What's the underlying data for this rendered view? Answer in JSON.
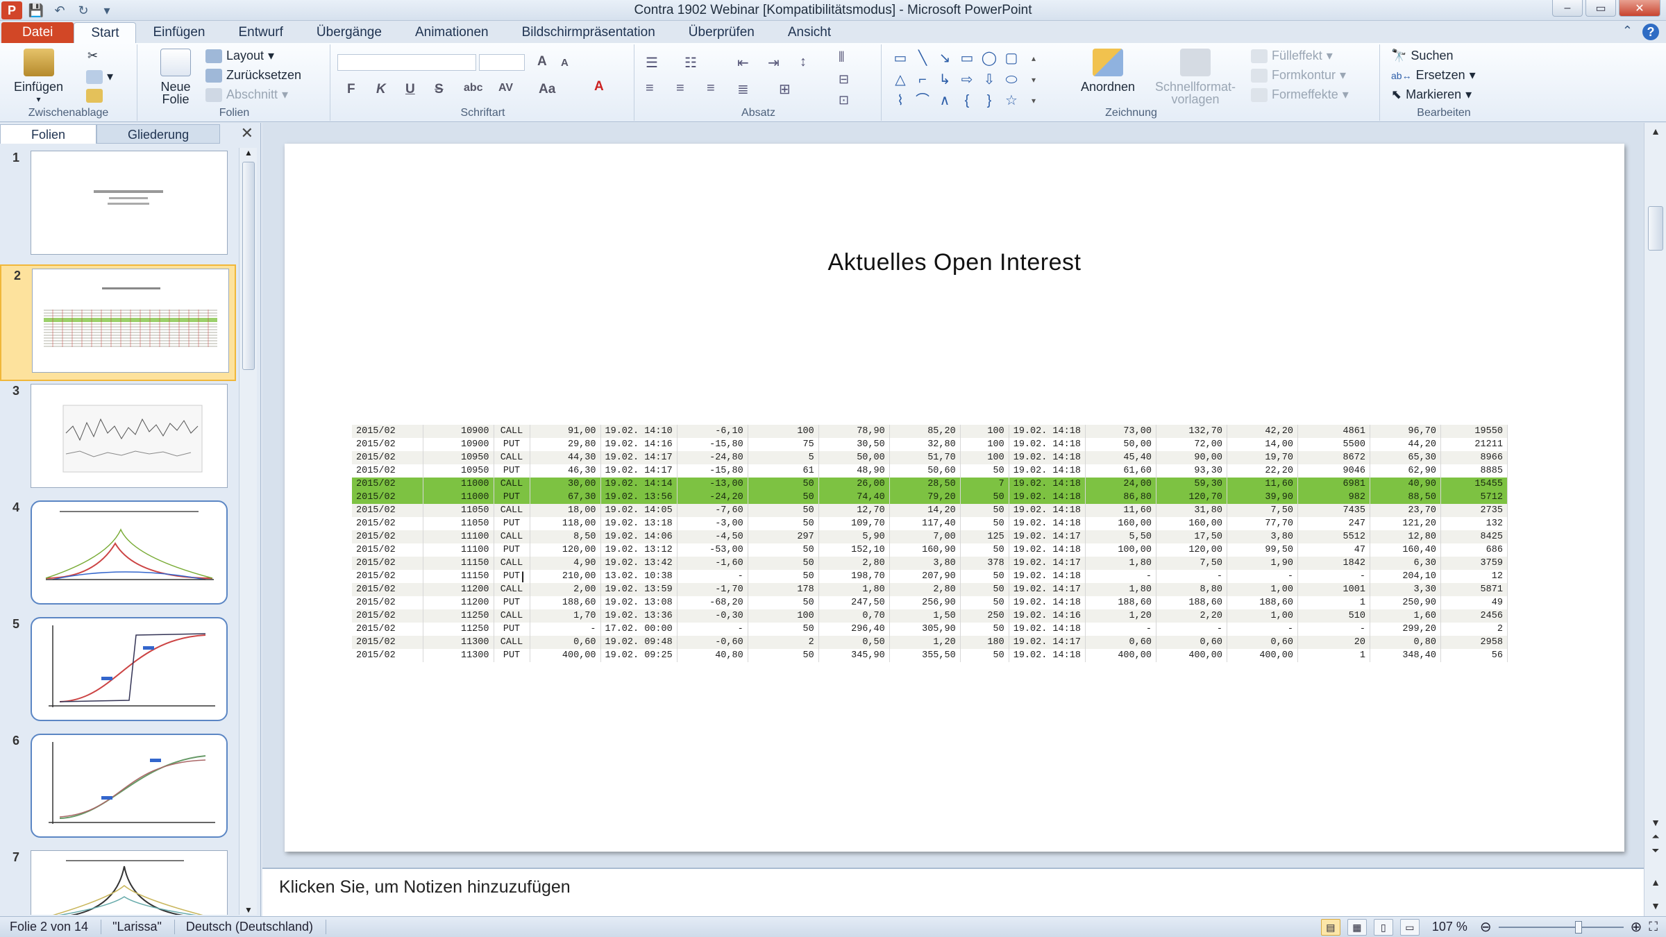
{
  "window": {
    "title": "Contra 1902 Webinar [Kompatibilitätsmodus] - Microsoft PowerPoint",
    "app_icon": "P",
    "controls": [
      "–",
      "▭",
      "✕"
    ]
  },
  "tabs": [
    "Datei",
    "Start",
    "Einfügen",
    "Entwurf",
    "Übergänge",
    "Animationen",
    "Bildschirmpräsentation",
    "Überprüfen",
    "Ansicht"
  ],
  "ribbon": {
    "clipboard": {
      "paste": "Einfügen",
      "label": "Zwischenablage"
    },
    "slides": {
      "new_slide": "Neue Folie",
      "layout": "Layout",
      "reset": "Zurücksetzen",
      "section": "Abschnitt",
      "label": "Folien"
    },
    "font": {
      "label": "Schriftart",
      "bold": "F",
      "italic": "K",
      "underline": "U",
      "strike": "S",
      "shadow": "abc",
      "spacing": "AV",
      "case": "Aa",
      "grow": "A",
      "shrink": "A",
      "color": "A"
    },
    "paragraph": {
      "label": "Absatz"
    },
    "drawing": {
      "arrange": "Anordnen",
      "quick_styles": "Schnellformat-vorlagen",
      "fill": "Fülleffekt",
      "outline": "Formkontur",
      "effects": "Formeffekte",
      "label": "Zeichnung"
    },
    "editing": {
      "find": "Suchen",
      "replace": "Ersetzen",
      "select": "Markieren",
      "label": "Bearbeiten"
    }
  },
  "left_pane": {
    "tabs": [
      "Folien",
      "Gliederung"
    ],
    "slide_numbers": [
      "1",
      "2",
      "3",
      "4",
      "5",
      "6",
      "7"
    ],
    "selected": 2
  },
  "slide": {
    "title": "Aktuelles Open Interest",
    "rows": [
      [
        "2015/02",
        "10900",
        "CALL",
        "91,00",
        "19.02. 14:10",
        "-6,10",
        "100",
        "78,90",
        "85,20",
        "100",
        "19.02. 14:18",
        "73,00",
        "132,70",
        "42,20",
        "4861",
        "96,70",
        "19550"
      ],
      [
        "2015/02",
        "10900",
        "PUT",
        "29,80",
        "19.02. 14:16",
        "-15,80",
        "75",
        "30,50",
        "32,80",
        "100",
        "19.02. 14:18",
        "50,00",
        "72,00",
        "14,00",
        "5500",
        "44,20",
        "21211"
      ],
      [
        "2015/02",
        "10950",
        "CALL",
        "44,30",
        "19.02. 14:17",
        "-24,80",
        "5",
        "50,00",
        "51,70",
        "100",
        "19.02. 14:18",
        "45,40",
        "90,00",
        "19,70",
        "8672",
        "65,30",
        "8966"
      ],
      [
        "2015/02",
        "10950",
        "PUT",
        "46,30",
        "19.02. 14:17",
        "-15,80",
        "61",
        "48,90",
        "50,60",
        "50",
        "19.02. 14:18",
        "61,60",
        "93,30",
        "22,20",
        "9046",
        "62,90",
        "8885"
      ],
      [
        "2015/02",
        "11000",
        "CALL",
        "30,00",
        "19.02. 14:14",
        "-13,00",
        "50",
        "26,00",
        "28,50",
        "7",
        "19.02. 14:18",
        "24,00",
        "59,30",
        "11,60",
        "6981",
        "40,90",
        "15455"
      ],
      [
        "2015/02",
        "11000",
        "PUT",
        "67,30",
        "19.02. 13:56",
        "-24,20",
        "50",
        "74,40",
        "79,20",
        "50",
        "19.02. 14:18",
        "86,80",
        "120,70",
        "39,90",
        "982",
        "88,50",
        "5712"
      ],
      [
        "2015/02",
        "11050",
        "CALL",
        "18,00",
        "19.02. 14:05",
        "-7,60",
        "50",
        "12,70",
        "14,20",
        "50",
        "19.02. 14:18",
        "11,60",
        "31,80",
        "7,50",
        "7435",
        "23,70",
        "2735"
      ],
      [
        "2015/02",
        "11050",
        "PUT",
        "118,00",
        "19.02. 13:18",
        "-3,00",
        "50",
        "109,70",
        "117,40",
        "50",
        "19.02. 14:18",
        "160,00",
        "160,00",
        "77,70",
        "247",
        "121,20",
        "132"
      ],
      [
        "2015/02",
        "11100",
        "CALL",
        "8,50",
        "19.02. 14:06",
        "-4,50",
        "297",
        "5,90",
        "7,00",
        "125",
        "19.02. 14:17",
        "5,50",
        "17,50",
        "3,80",
        "5512",
        "12,80",
        "8425"
      ],
      [
        "2015/02",
        "11100",
        "PUT",
        "120,00",
        "19.02. 13:12",
        "-53,00",
        "50",
        "152,10",
        "160,90",
        "50",
        "19.02. 14:18",
        "100,00",
        "120,00",
        "99,50",
        "47",
        "160,40",
        "686"
      ],
      [
        "2015/02",
        "11150",
        "CALL",
        "4,90",
        "19.02. 13:42",
        "-1,60",
        "50",
        "2,80",
        "3,80",
        "378",
        "19.02. 14:17",
        "1,80",
        "7,50",
        "1,90",
        "1842",
        "6,30",
        "3759"
      ],
      [
        "2015/02",
        "11150",
        "PUT",
        "210,00",
        "13.02. 10:38",
        "-",
        "50",
        "198,70",
        "207,90",
        "50",
        "19.02. 14:18",
        "-",
        "-",
        "-",
        "-",
        "204,10",
        "12"
      ],
      [
        "2015/02",
        "11200",
        "CALL",
        "2,00",
        "19.02. 13:59",
        "-1,70",
        "178",
        "1,80",
        "2,80",
        "50",
        "19.02. 14:17",
        "1,80",
        "8,80",
        "1,00",
        "1001",
        "3,30",
        "5871"
      ],
      [
        "2015/02",
        "11200",
        "PUT",
        "188,60",
        "19.02. 13:08",
        "-68,20",
        "50",
        "247,50",
        "256,90",
        "50",
        "19.02. 14:18",
        "188,60",
        "188,60",
        "188,60",
        "1",
        "250,90",
        "49"
      ],
      [
        "2015/02",
        "11250",
        "CALL",
        "1,70",
        "19.02. 13:36",
        "-0,30",
        "100",
        "0,70",
        "1,50",
        "250",
        "19.02. 14:16",
        "1,20",
        "2,20",
        "1,00",
        "510",
        "1,60",
        "2456"
      ],
      [
        "2015/02",
        "11250",
        "PUT",
        "-",
        "17.02. 00:00",
        "-",
        "50",
        "296,40",
        "305,90",
        "50",
        "19.02. 14:18",
        "-",
        "-",
        "-",
        "-",
        "299,20",
        "2"
      ],
      [
        "2015/02",
        "11300",
        "CALL",
        "0,60",
        "19.02. 09:48",
        "-0,60",
        "2",
        "0,50",
        "1,20",
        "180",
        "19.02. 14:17",
        "0,60",
        "0,60",
        "0,60",
        "20",
        "0,80",
        "2958"
      ],
      [
        "2015/02",
        "11300",
        "PUT",
        "400,00",
        "19.02. 09:25",
        "40,80",
        "50",
        "345,90",
        "355,50",
        "50",
        "19.02. 14:18",
        "400,00",
        "400,00",
        "400,00",
        "1",
        "348,40",
        "56"
      ]
    ],
    "highlight_color": "#7dc242"
  },
  "notes": {
    "placeholder": "Klicken Sie, um Notizen hinzuzufügen"
  },
  "status": {
    "slide": "Folie 2 von 14",
    "theme": "\"Larissa\"",
    "language": "Deutsch (Deutschland)",
    "zoom": "107 %"
  }
}
